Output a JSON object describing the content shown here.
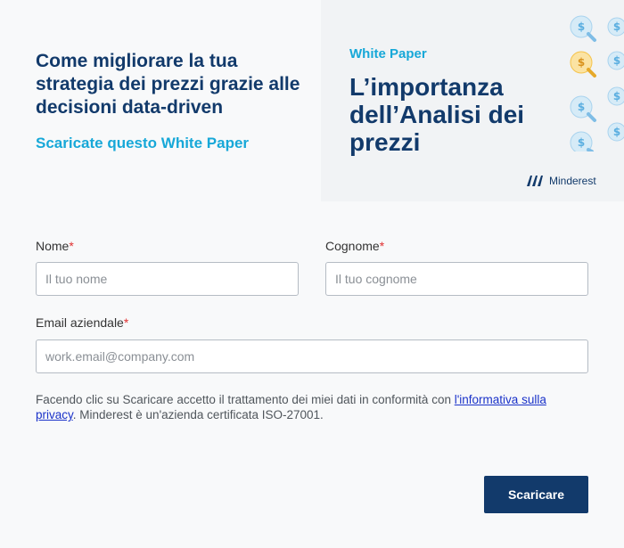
{
  "hero": {
    "title": "Come migliorare la tua strategia dei prezzi grazie alle decisioni data-driven",
    "subtitle": "Scaricate questo White Paper"
  },
  "cover": {
    "label": "White Paper",
    "title": "L’importanza dell’Analisi dei prezzi",
    "brand": "Minderest",
    "icons": [
      "dollar-magnifier-icon"
    ],
    "colors": {
      "navy": "#123a6b",
      "cyan": "#17a8d8",
      "coin_blue": "#cfe8f6",
      "coin_gold": "#f5c34a"
    }
  },
  "form": {
    "first_name": {
      "label": "Nome",
      "required_mark": "*",
      "placeholder": "Il tuo nome"
    },
    "last_name": {
      "label": "Cognome",
      "required_mark": "*",
      "placeholder": "Il tuo cognome"
    },
    "email": {
      "label": "Email aziendale",
      "required_mark": "*",
      "placeholder": "work.email@company.com"
    },
    "consent_prefix": "Facendo clic su Scaricare accetto il trattamento dei miei dati in conformità con ",
    "consent_link": "l'informativa sulla privacy",
    "consent_suffix": ". Minderest è un'azienda certificata ISO-27001.",
    "submit_label": "Scaricare"
  }
}
